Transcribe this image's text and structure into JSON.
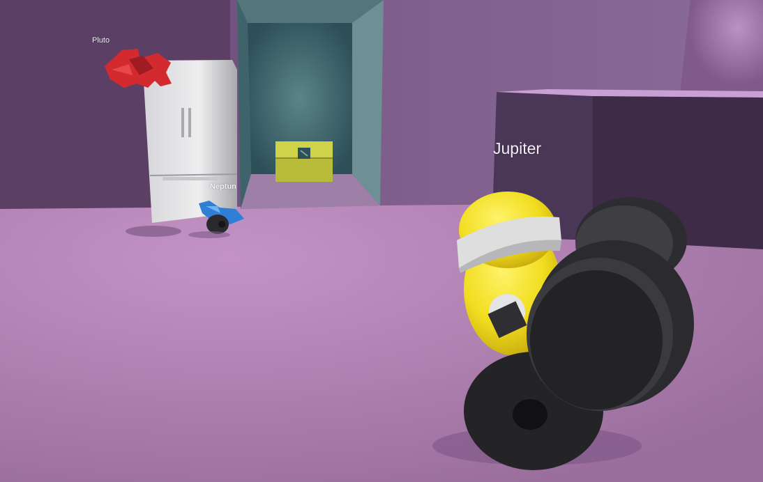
{
  "players": [
    {
      "name": "Pluto",
      "robot_color": "#d8262c"
    },
    {
      "name": "Neptun",
      "robot_color": "#2f7fd6"
    },
    {
      "name": "Jupiter",
      "robot_color": "#f1dd1f"
    }
  ],
  "scene": {
    "wall_color": "#7a5a86",
    "floor_color": "#b07fb0",
    "doorway_color": "#456e78",
    "treasure_chest_color": "#c6c940",
    "fridge_color": "#d9d9dc",
    "crate_color": "#4a3656"
  },
  "icons": [
    "fridge-icon",
    "treasure-chest-icon",
    "robot-icon"
  ]
}
